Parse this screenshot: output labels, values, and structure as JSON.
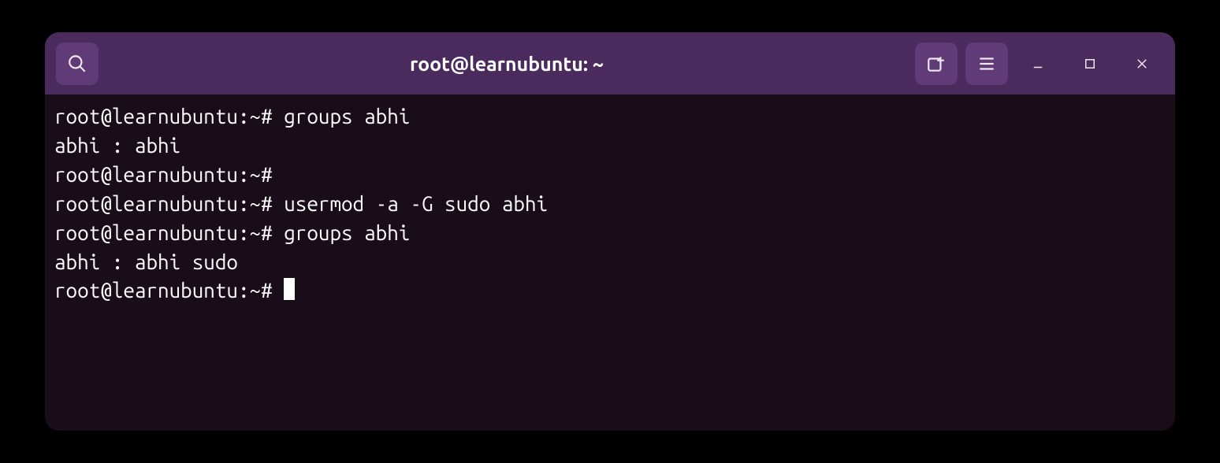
{
  "window": {
    "title": "root@learnubuntu: ~"
  },
  "terminal": {
    "lines": [
      "root@learnubuntu:~# groups abhi",
      "abhi : abhi",
      "root@learnubuntu:~# ",
      "root@learnubuntu:~# usermod -a -G sudo abhi",
      "root@learnubuntu:~# groups abhi",
      "abhi : abhi sudo",
      "root@learnubuntu:~# "
    ]
  }
}
